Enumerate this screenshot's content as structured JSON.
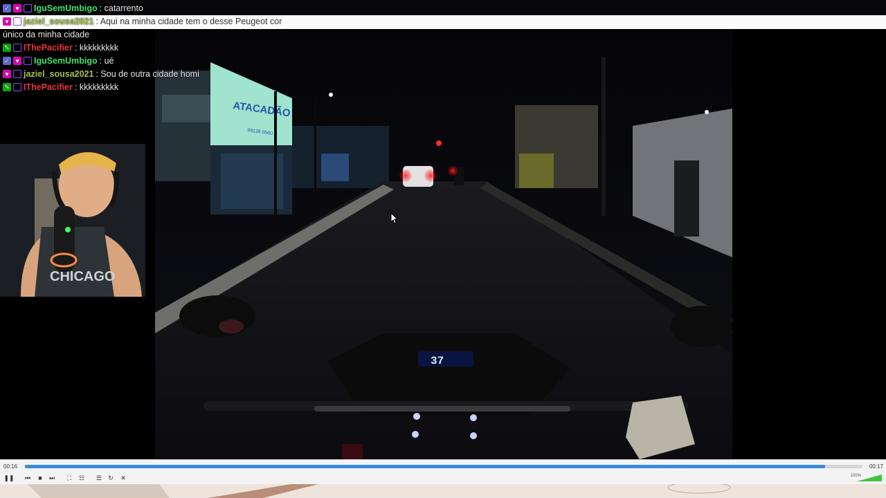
{
  "chat": {
    "messages": [
      {
        "user": "IguSemUmbigo",
        "user_color": "#3ee06a",
        "badges": [
          "ver",
          "vip",
          "prime"
        ],
        "text": ": catarrento"
      },
      {
        "user": "jaziel_sousa2021",
        "user_color": "#a6c24a",
        "badges": [
          "vip",
          "prime"
        ],
        "text": ": Aqui na minha cidade tem o desse Peugeot cor"
      },
      {
        "user": "",
        "user_color": "#e6e6e6",
        "badges": [],
        "text": "único da minha cidade"
      },
      {
        "user": "IThePacifier",
        "user_color": "#e8353b",
        "badges": [
          "mod",
          "prime"
        ],
        "text": ": kkkkkkkkk"
      },
      {
        "user": "IguSemUmbigo",
        "user_color": "#3ee06a",
        "badges": [
          "ver",
          "vip",
          "prime"
        ],
        "text": ": ué"
      },
      {
        "user": "jaziel_sousa2021",
        "user_color": "#a6c24a",
        "badges": [
          "vip",
          "prime"
        ],
        "text": ": Sou de outra cidade homi"
      },
      {
        "user": "IThePacifier",
        "user_color": "#e8353b",
        "badges": [
          "mod",
          "prime"
        ],
        "text": ": kkkkkkkkk"
      }
    ]
  },
  "speedometer": {
    "speed": "37"
  },
  "webcam": {
    "shirt_text": "CHICAGO"
  },
  "billboard": {
    "title": "ATACADÃO",
    "phone": "99138 0560"
  },
  "player": {
    "time_elapsed": "00:16",
    "time_total": "00:17",
    "progress_fraction": 0.955,
    "volume_label": "100%",
    "accent_color": "#3b8ad9",
    "buttons": [
      "pause-icon",
      "previous-icon",
      "stop-icon",
      "next-icon",
      "fullscreen-icon",
      "equalizer-icon",
      "playlist-icon",
      "loop-icon",
      "shuffle-icon"
    ]
  }
}
